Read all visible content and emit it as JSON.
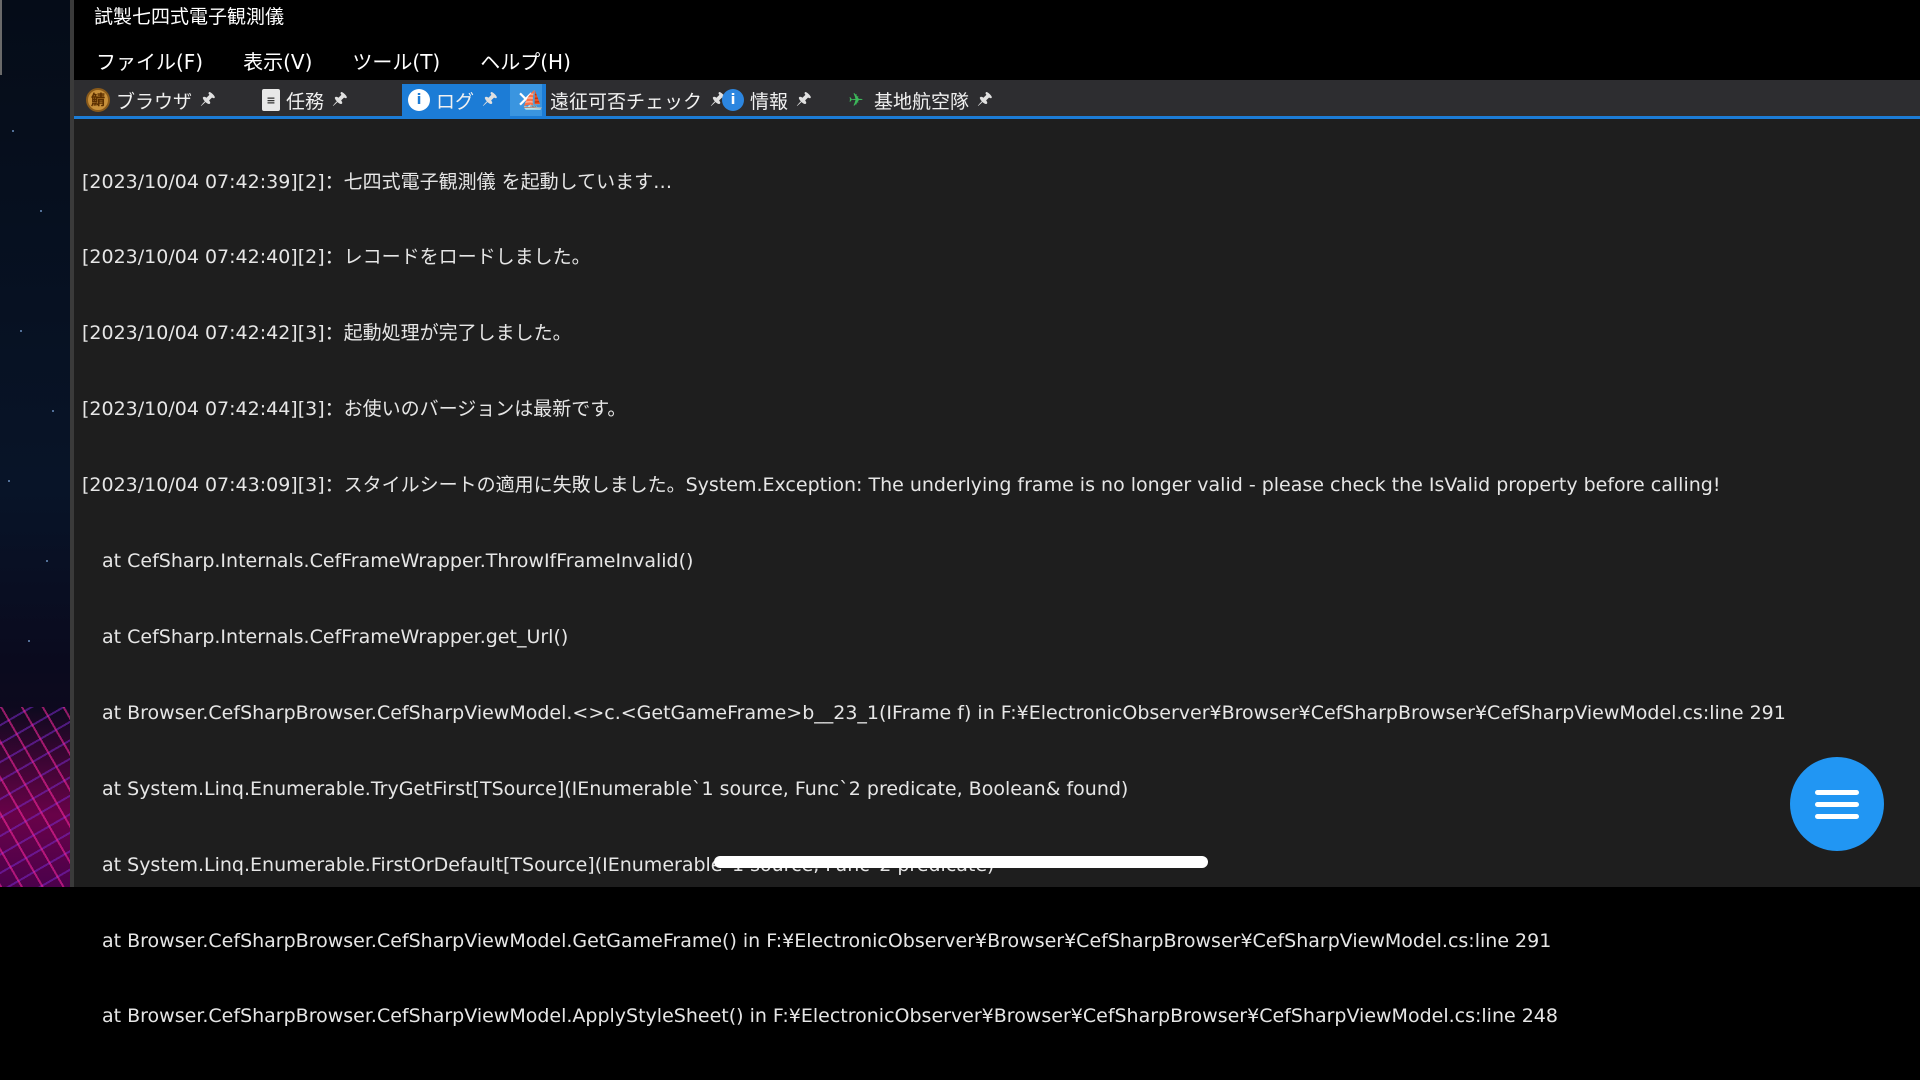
{
  "app": {
    "title": "試製七四式電子観測儀"
  },
  "menu": [
    {
      "label": "ファイル(F)"
    },
    {
      "label": "表示(V)"
    },
    {
      "label": "ツール(T)"
    },
    {
      "label": "ヘルプ(H)"
    }
  ],
  "tabs": [
    {
      "label": "ブラウザ",
      "icon": "browser-icon",
      "pin": "🖈"
    },
    {
      "label": "任務",
      "icon": "quest-icon",
      "pin": "🖈"
    },
    {
      "label": "ログ",
      "icon": "info-icon",
      "pin": "🖈",
      "close": "✕",
      "active": true
    },
    {
      "label": "遠征可否チェック",
      "icon": "expedition-icon",
      "pin": "🖈"
    },
    {
      "label": "情報",
      "icon": "info-icon",
      "pin": "🖈"
    },
    {
      "label": "基地航空隊",
      "icon": "plane-icon",
      "pin": "🖈"
    }
  ],
  "log": {
    "entries": [
      "[2023/10/04 07:42:39][2]：七四式電子観測儀 を起動しています…",
      "[2023/10/04 07:42:40][2]：レコードをロードしました。",
      "[2023/10/04 07:42:42][3]：起動処理が完了しました。",
      "[2023/10/04 07:42:44][3]：お使いのバージョンは最新です。",
      "[2023/10/04 07:43:09][3]：スタイルシートの適用に失敗しました。System.Exception: The underlying frame is no longer valid - please check the IsValid property before calling!"
    ],
    "stack_trace": [
      "at CefSharp.Internals.CefFrameWrapper.ThrowIfFrameInvalid()",
      "at CefSharp.Internals.CefFrameWrapper.get_Url()",
      "at Browser.CefSharpBrowser.CefSharpViewModel.<>c.<GetGameFrame>b__23_1(IFrame f) in F:¥ElectronicObserver¥Browser¥CefSharpBrowser¥CefSharpViewModel.cs:line 291",
      "at System.Linq.Enumerable.TryGetFirst[TSource](IEnumerable`1 source, Func`2 predicate, Boolean& found)",
      "at System.Linq.Enumerable.FirstOrDefault[TSource](IEnumerable`1 source, Func`2 predicate)",
      "at Browser.CefSharpBrowser.CefSharpViewModel.GetGameFrame() in F:¥ElectronicObserver¥Browser¥CefSharpBrowser¥CefSharpViewModel.cs:line 291",
      "at Browser.CefSharpBrowser.CefSharpViewModel.ApplyStyleSheet() in F:¥ElectronicObserver¥Browser¥CefSharpBrowser¥CefSharpViewModel.cs:line 248"
    ]
  },
  "fab": {
    "icon": "hamburger-menu-icon"
  },
  "colors": {
    "accent": "#1c7cd6",
    "fab": "#2196f3",
    "content_bg": "#1e1e1e",
    "tab_strip_bg": "#2d2d30"
  }
}
